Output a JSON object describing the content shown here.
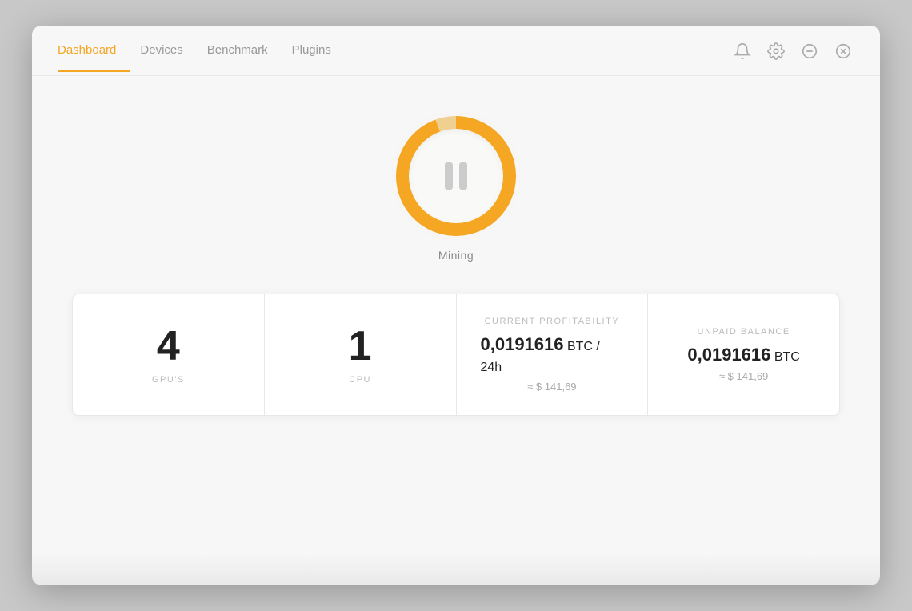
{
  "nav": {
    "items": [
      {
        "id": "dashboard",
        "label": "Dashboard",
        "active": true
      },
      {
        "id": "devices",
        "label": "Devices",
        "active": false
      },
      {
        "id": "benchmark",
        "label": "Benchmark",
        "active": false
      },
      {
        "id": "plugins",
        "label": "Plugins",
        "active": false
      }
    ],
    "icons": [
      {
        "id": "notification",
        "name": "bell-icon"
      },
      {
        "id": "settings",
        "name": "gear-icon"
      },
      {
        "id": "minimize",
        "name": "minimize-icon"
      },
      {
        "id": "close",
        "name": "close-icon"
      }
    ]
  },
  "mining": {
    "button_label": "Mining",
    "status": "paused"
  },
  "stats": [
    {
      "id": "gpus",
      "number": "4",
      "label": "GPU'S"
    },
    {
      "id": "cpu",
      "number": "1",
      "label": "CPU"
    },
    {
      "id": "profitability",
      "top_label": "CURRENT PROFITABILITY",
      "value": "0,0191616",
      "unit": " BTC / 24h",
      "approx": "≈ $ 141,69"
    },
    {
      "id": "balance",
      "top_label": "UNPAID BALANCE",
      "value": "0,0191616",
      "unit": " BTC",
      "approx": "≈ $ 141,69"
    }
  ]
}
